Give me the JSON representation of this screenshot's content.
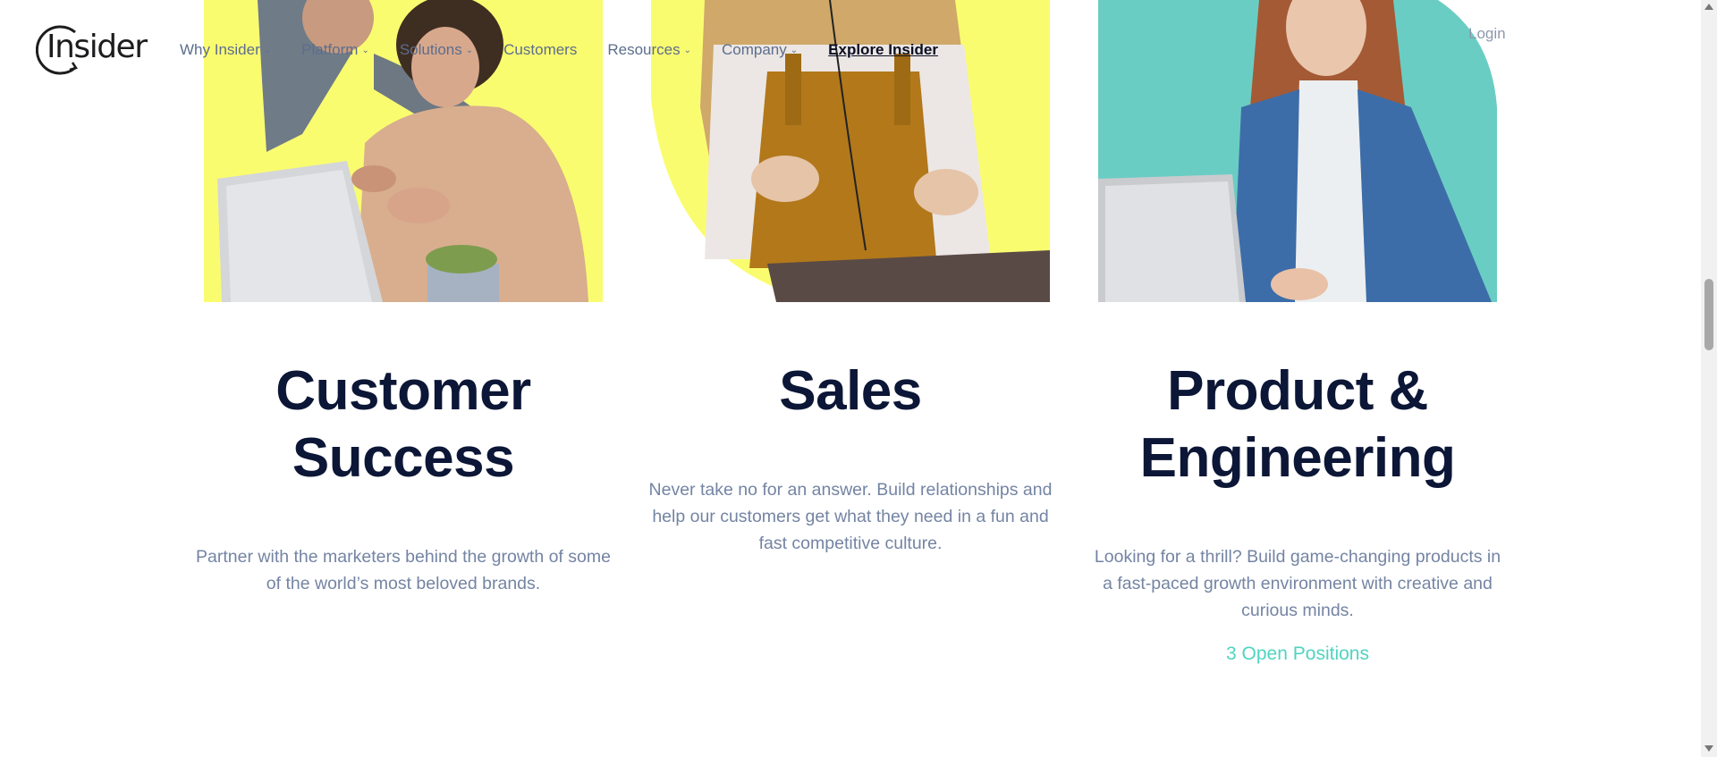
{
  "header": {
    "logo_text": "Insider",
    "nav": [
      {
        "label": "Why Insider",
        "has_dropdown": true
      },
      {
        "label": "Platform",
        "has_dropdown": true
      },
      {
        "label": "Solutions",
        "has_dropdown": true
      },
      {
        "label": "Customers",
        "has_dropdown": false
      },
      {
        "label": "Resources",
        "has_dropdown": true
      },
      {
        "label": "Company",
        "has_dropdown": true
      },
      {
        "label": "Explore Insider",
        "has_dropdown": false
      }
    ],
    "login_label": "Login"
  },
  "departments": [
    {
      "title_line1": "Customer",
      "title_line2": "Success",
      "description": "Partner with the marketers behind the growth of some of the world’s most beloved brands.",
      "photo_background": "#fafc70"
    },
    {
      "title_line1": "Sales",
      "description": "Never take no for an answer. Build relationships and help our customers get what they need in a fun and fast competitive culture.",
      "photo_background": "#fafc70"
    },
    {
      "title_line1": "Product &",
      "title_line2": "Engineering",
      "description": "Looking for a thrill? Build game-changing products in a fast-paced growth environment with creative and curious minds.",
      "open_positions": "3 Open Positions",
      "photo_background": "#6acdc3"
    }
  ],
  "colors": {
    "heading": "#0c1636",
    "body_text": "#7484a3",
    "accent": "#4fd4c0",
    "nav_text": "#5c6e8d"
  }
}
